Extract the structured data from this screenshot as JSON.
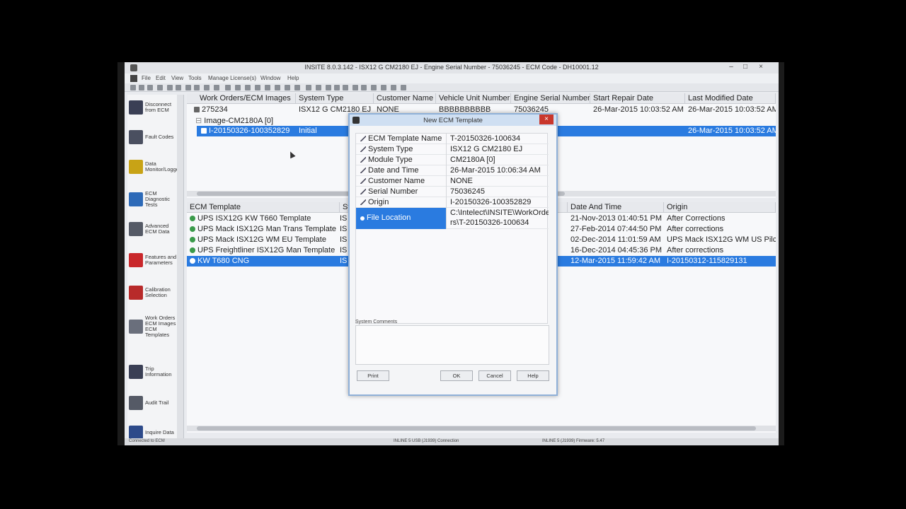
{
  "window": {
    "title": "INSITE 8.0.3.142 - ISX12 G CM2180 EJ - Engine Serial Number - 75036245 - ECM Code - DH10001.12"
  },
  "menu": [
    "File",
    "Edit",
    "View",
    "Tools",
    "Manage License(s)",
    "Window",
    "Help"
  ],
  "sidebar": {
    "items": [
      {
        "label": "Disconnect from ECM",
        "icon": "disconnect-icon",
        "color": "#3a3f55"
      },
      {
        "label": "Fault Codes",
        "icon": "fault-codes-icon",
        "color": "#4a4f60"
      },
      {
        "label": "Data Monitor/Logger",
        "icon": "data-monitor-icon",
        "color": "#c8a316"
      },
      {
        "label": "ECM Diagnostic Tests",
        "icon": "diagnostic-tests-icon",
        "color": "#2d6ab8"
      },
      {
        "label": "Advanced ECM Data",
        "icon": "advanced-data-icon",
        "color": "#555a66"
      },
      {
        "label": "Features and Parameters",
        "icon": "features-icon",
        "color": "#c9272b"
      },
      {
        "label": "Calibration Selection",
        "icon": "calibration-icon",
        "color": "#b82a2a"
      },
      {
        "label": "Work Orders ECM Images ECM Templates",
        "icon": "work-orders-icon",
        "color": "#6a6f7c"
      },
      {
        "label": "Trip Information",
        "icon": "trip-info-icon",
        "color": "#3a3f55"
      },
      {
        "label": "Audit Trail",
        "icon": "audit-trail-icon",
        "color": "#555a66"
      },
      {
        "label": "Inquire Data",
        "icon": "inquire-data-icon",
        "color": "#2d4a8a"
      }
    ]
  },
  "work_orders": {
    "columns": [
      "Work Orders/ECM Images",
      "System Type",
      "Customer Name",
      "Vehicle Unit Number",
      "Engine Serial Number",
      "Start Repair Date",
      "Last Modified Date"
    ],
    "rows": [
      [
        "275234",
        "ISX12 G CM2180 EJ",
        "NONE",
        "BBBBBBBBBB",
        "75036245",
        "26-Mar-2015 10:03:52 AM",
        "26-Mar-2015 10:03:52 AM"
      ],
      [
        "Image-CM2180A [0]",
        "",
        "",
        "",
        "",
        "",
        ""
      ],
      [
        "I-20150326-100352829",
        "Initial",
        "",
        "",
        "",
        "",
        "26-Mar-2015 10:03:52 AM"
      ]
    ]
  },
  "templates": {
    "columns": [
      "ECM Template",
      "Sy",
      "Date And Time",
      "Origin"
    ],
    "rows": [
      {
        "name": "UPS ISX12G KW T660 Template",
        "sys": "IS",
        "date": "21-Nov-2013 01:40:51 PM",
        "origin": "After Corrections"
      },
      {
        "name": "UPS Mack ISX12G Man Trans Template",
        "sys": "IS",
        "date": "27-Feb-2014 07:44:50 PM",
        "origin": "After corrections"
      },
      {
        "name": "UPS Mack ISX12G WM EU Template",
        "sys": "IS",
        "date": "02-Dec-2014 11:01:59 AM",
        "origin": "UPS Mack ISX12G WM US Pilc"
      },
      {
        "name": "UPS Freightliner ISX12G Man Template",
        "sys": "IS",
        "date": "16-Dec-2014 04:45:36 PM",
        "origin": "After corrections"
      },
      {
        "name": "KW T680 CNG",
        "sys": "IS",
        "date": "12-Mar-2015 11:59:42 AM",
        "origin": "I-20150312-115829131"
      }
    ]
  },
  "dialog": {
    "title": "New ECM Template",
    "properties": [
      {
        "key": "ECM Template Name",
        "value": "T-20150326-100634"
      },
      {
        "key": "System Type",
        "value": "ISX12 G CM2180 EJ"
      },
      {
        "key": "Module Type",
        "value": "CM2180A [0]"
      },
      {
        "key": "Date and Time",
        "value": "26-Mar-2015 10:06:34 AM"
      },
      {
        "key": "Customer Name",
        "value": "NONE"
      },
      {
        "key": "Serial Number",
        "value": "75036245"
      },
      {
        "key": "Origin",
        "value": "I-20150326-100352829"
      }
    ],
    "file_location": {
      "key": "File Location",
      "line1": "C:\\Intelect\\INSITE\\WorkOrde",
      "line2": "rs\\T-20150326-100634"
    },
    "system_comments_label": "System Comments",
    "system_comments_value": "",
    "buttons": {
      "print": "Print",
      "ok": "OK",
      "cancel": "Cancel",
      "help": "Help"
    }
  },
  "status": {
    "left": "Connected to ECM",
    "adapter": "INLINE 5 USB (J1939) Connection",
    "right": "INLINE 5 (J1939) Firmware: 5.47"
  },
  "colors": {
    "selection": "#2a7be0",
    "dialog_border": "#8fb0d8",
    "close": "#c9372c"
  }
}
